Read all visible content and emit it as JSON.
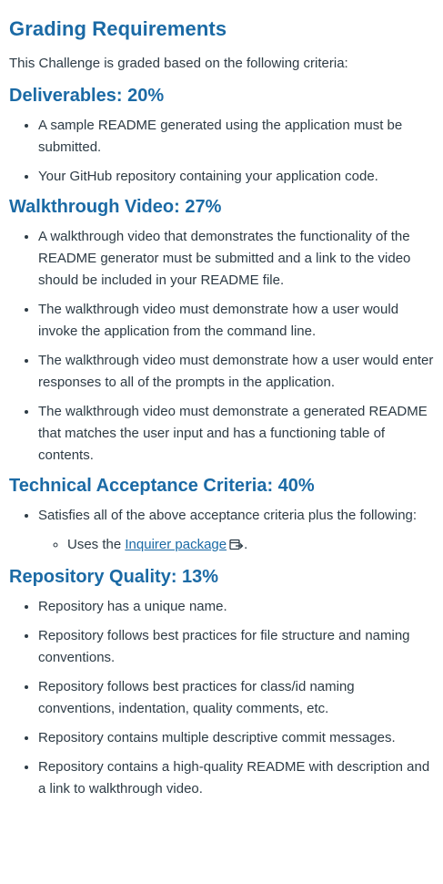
{
  "title": "Grading Requirements",
  "intro": "This Challenge is graded based on the following criteria:",
  "sections": [
    {
      "heading": "Deliverables: 20%",
      "items": [
        "A sample README generated using the application must be submitted.",
        "Your GitHub repository containing your application code."
      ]
    },
    {
      "heading": "Walkthrough Video: 27%",
      "items": [
        "A walkthrough video that demonstrates the functionality of the README generator must be submitted and a link to the video should be included in your README file.",
        "The walkthrough video must demonstrate how a user would invoke the application from the command line.",
        "The walkthrough video must demonstrate how a user would enter responses to all of the prompts in the application.",
        "The walkthrough video must demonstrate a generated README that matches the user input and has a functioning table of contents."
      ]
    },
    {
      "heading": "Technical Acceptance Criteria: 40%",
      "items": [
        "Satisfies all of the above acceptance criteria plus the following:"
      ],
      "subitem": {
        "prefix": "Uses the ",
        "link": "Inquirer package",
        "suffix": "."
      }
    },
    {
      "heading": "Repository Quality: 13%",
      "items": [
        "Repository has a unique name.",
        "Repository follows best practices for file structure and naming conventions.",
        "Repository follows best practices for class/id naming conventions, indentation, quality comments, etc.",
        "Repository contains multiple descriptive commit messages.",
        "Repository contains a high-quality README with description and a link to walkthrough video."
      ]
    }
  ],
  "icons": {
    "external_link": "external-link-icon"
  },
  "colors": {
    "heading": "#1b6aa5",
    "text": "#2d3b45",
    "link": "#1b6aa5"
  }
}
